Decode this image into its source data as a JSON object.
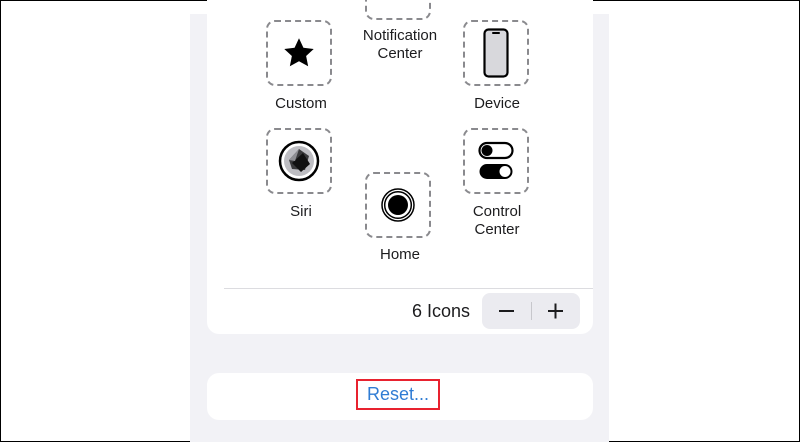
{
  "menu": {
    "items": [
      {
        "label": "Notification\nCenter",
        "icon": "notification-center-icon"
      },
      {
        "label": "Custom",
        "icon": "star-icon"
      },
      {
        "label": "Device",
        "icon": "iphone-device-icon"
      },
      {
        "label": "Siri",
        "icon": "siri-icon"
      },
      {
        "label": "Home",
        "icon": "home-button-icon"
      },
      {
        "label": "Control\nCenter",
        "icon": "control-center-toggles-icon"
      }
    ]
  },
  "icon_count": {
    "label": "6 Icons"
  },
  "stepper": {
    "minus": "−",
    "plus": "+"
  },
  "reset": {
    "label": "Reset..."
  },
  "colors": {
    "accent_blue": "#2f7cd4",
    "highlight_red": "#e8222f",
    "group_bg": "#f2f2f6"
  }
}
